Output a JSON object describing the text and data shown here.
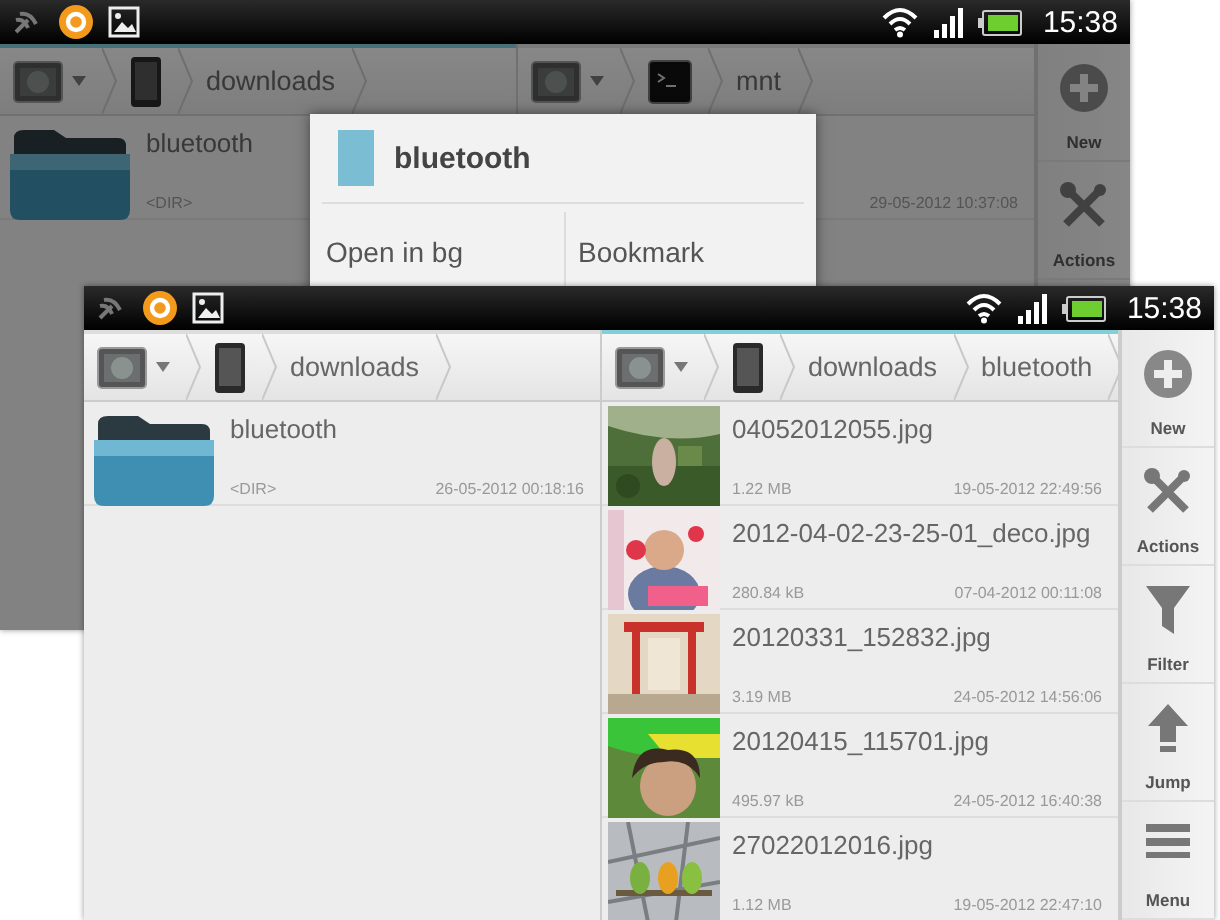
{
  "screens": [
    {
      "dimmed": true,
      "status_bar": {
        "time": "15:38"
      },
      "panes": [
        {
          "active": true,
          "breadcrumbs": [
            {
              "kind": "drive"
            },
            {
              "kind": "phone"
            },
            {
              "kind": "folder",
              "label": "downloads"
            }
          ],
          "files": [
            {
              "kind": "folder",
              "name": "bluetooth",
              "size": "<DIR>"
            }
          ]
        },
        {
          "active": false,
          "breadcrumbs": [
            {
              "kind": "drive"
            },
            {
              "kind": "terminal"
            },
            {
              "kind": "folder",
              "label": "mnt"
            }
          ],
          "files": [
            {
              "date": "29-05-2012 10:37:08"
            }
          ]
        }
      ],
      "toolbar": [
        {
          "kind": "new",
          "label": "New"
        },
        {
          "kind": "actions",
          "label": "Actions"
        }
      ],
      "dialog": {
        "title": "bluetooth",
        "buttons": [
          "Open in bg",
          "Bookmark"
        ]
      }
    },
    {
      "dimmed": false,
      "status_bar": {
        "time": "15:38"
      },
      "panes": [
        {
          "active": false,
          "breadcrumbs": [
            {
              "kind": "drive"
            },
            {
              "kind": "phone"
            },
            {
              "kind": "folder",
              "label": "downloads"
            }
          ],
          "files": [
            {
              "kind": "folder",
              "name": "bluetooth",
              "size": "<DIR>",
              "date": "26-05-2012 00:18:16"
            }
          ]
        },
        {
          "active": true,
          "breadcrumbs": [
            {
              "kind": "drive"
            },
            {
              "kind": "phone"
            },
            {
              "kind": "folder",
              "label": "downloads"
            },
            {
              "kind": "folder",
              "label": "bluetooth"
            }
          ],
          "files": [
            {
              "name": "04052012055.jpg",
              "size": "1.22 MB",
              "date": "19-05-2012 22:49:56"
            },
            {
              "name": "2012-04-02-23-25-01_deco.jpg",
              "size": "280.84 kB",
              "date": "07-04-2012 00:11:08"
            },
            {
              "name": "20120331_152832.jpg",
              "size": "3.19 MB",
              "date": "24-05-2012 14:56:06"
            },
            {
              "name": "20120415_115701.jpg",
              "size": "495.97 kB",
              "date": "24-05-2012 16:40:38"
            },
            {
              "name": "27022012016.jpg",
              "size": "1.12 MB",
              "date": "19-05-2012 22:47:10"
            }
          ]
        }
      ],
      "toolbar": [
        {
          "kind": "new",
          "label": "New"
        },
        {
          "kind": "actions",
          "label": "Actions"
        },
        {
          "kind": "filter",
          "label": "Filter"
        },
        {
          "kind": "jump",
          "label": "Jump"
        },
        {
          "kind": "menu",
          "label": "Menu"
        }
      ]
    }
  ]
}
